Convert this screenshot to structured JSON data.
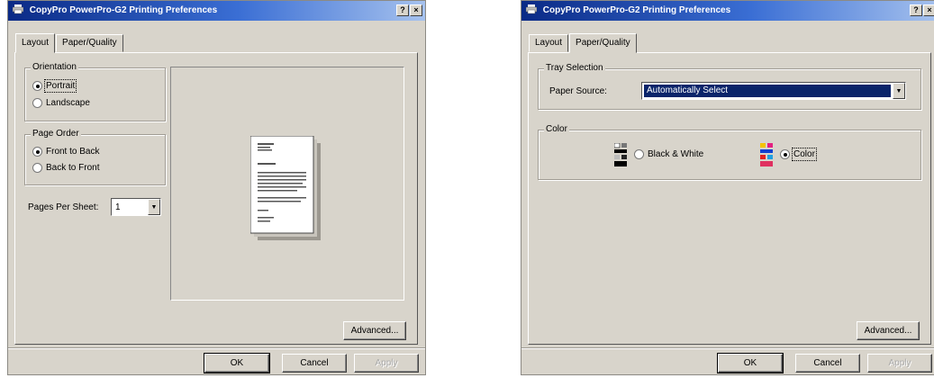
{
  "layout_dialog": {
    "title": "CopyPro PowerPro-G2 Printing Preferences",
    "title_buttons": {
      "help": "?",
      "close": "×"
    },
    "tabs": [
      {
        "label": "Layout",
        "active": true
      },
      {
        "label": "Paper/Quality",
        "active": false
      }
    ],
    "orientation": {
      "label": "Orientation",
      "options": [
        {
          "label": "Portrait",
          "selected": true
        },
        {
          "label": "Landscape",
          "selected": false
        }
      ]
    },
    "page_order": {
      "label": "Page Order",
      "options": [
        {
          "label": "Front to Back",
          "selected": true
        },
        {
          "label": "Back to Front",
          "selected": false
        }
      ]
    },
    "pages_per_sheet": {
      "label": "Pages Per Sheet:",
      "value": "1"
    },
    "advanced_label": "Advanced...",
    "ok_label": "OK",
    "cancel_label": "Cancel",
    "apply_label": "Apply"
  },
  "paper_dialog": {
    "title": "CopyPro PowerPro-G2 Printing Preferences",
    "title_buttons": {
      "help": "?",
      "close": "×"
    },
    "tabs": [
      {
        "label": "Layout",
        "active": false
      },
      {
        "label": "Paper/Quality",
        "active": true
      }
    ],
    "tray_selection": {
      "label": "Tray Selection",
      "paper_source_label": "Paper Source:",
      "paper_source_value": "Automatically Select"
    },
    "color": {
      "label": "Color",
      "options": [
        {
          "label": "Black & White",
          "selected": false
        },
        {
          "label": "Color",
          "selected": true
        }
      ]
    },
    "advanced_label": "Advanced...",
    "ok_label": "OK",
    "cancel_label": "Cancel",
    "apply_label": "Apply"
  },
  "colors": {
    "titlebar_start": "#0a2a86",
    "titlebar_end": "#a6c2ee",
    "dialog_bg": "#d8d4cb",
    "selection": "#0a246a"
  }
}
